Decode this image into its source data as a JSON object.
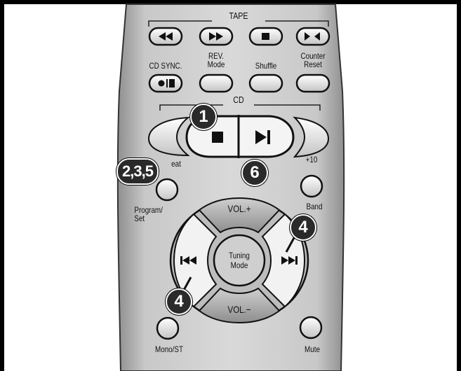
{
  "sections": {
    "tape": "TAPE",
    "cd": "CD"
  },
  "tape_buttons": [
    {
      "name": "rewind",
      "icon": "rewind-icon"
    },
    {
      "name": "fast-forward",
      "icon": "fast-forward-icon"
    },
    {
      "name": "stop",
      "icon": "stop-icon"
    },
    {
      "name": "direction",
      "icon": "direction-icon"
    }
  ],
  "row2_labels": {
    "cd_sync": "CD SYNC.",
    "rev_mode": [
      "REV.",
      "Mode"
    ],
    "shuffle": "Shuffle",
    "counter_reset": [
      "Counter",
      "Reset"
    ]
  },
  "cd_labels": {
    "repeat": "eat",
    "plus10": "+10"
  },
  "side_labels": {
    "program_set": [
      "Program/",
      "Set"
    ],
    "band": "Band",
    "mono_st": "Mono/ST",
    "mute": "Mute"
  },
  "dpad": {
    "vol_up": "VOL.+",
    "vol_down": "VOL.−",
    "center": [
      "Tuning",
      "Mode"
    ]
  },
  "callouts": {
    "c1": "1",
    "c6": "6",
    "c235": "2,3,5",
    "c4a": "4",
    "c4b": "4"
  },
  "colors": {
    "body": "#bdbdbd",
    "button": "#e6e6e6",
    "badge": "#2a2a2a",
    "frame": "#000000"
  }
}
